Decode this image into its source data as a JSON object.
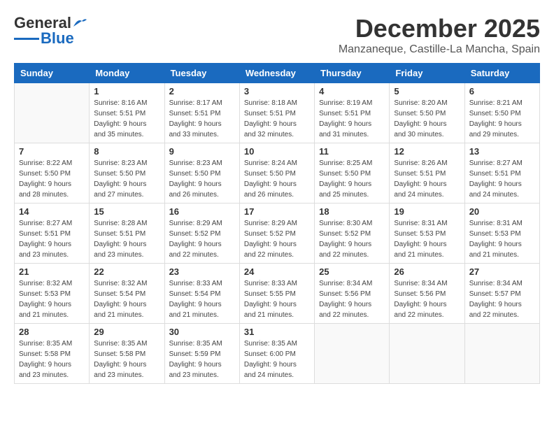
{
  "header": {
    "logo_general": "General",
    "logo_blue": "Blue",
    "month": "December 2025",
    "location": "Manzaneque, Castille-La Mancha, Spain"
  },
  "calendar": {
    "days_of_week": [
      "Sunday",
      "Monday",
      "Tuesday",
      "Wednesday",
      "Thursday",
      "Friday",
      "Saturday"
    ],
    "weeks": [
      [
        {
          "day": "",
          "info": ""
        },
        {
          "day": "1",
          "info": "Sunrise: 8:16 AM\nSunset: 5:51 PM\nDaylight: 9 hours\nand 35 minutes."
        },
        {
          "day": "2",
          "info": "Sunrise: 8:17 AM\nSunset: 5:51 PM\nDaylight: 9 hours\nand 33 minutes."
        },
        {
          "day": "3",
          "info": "Sunrise: 8:18 AM\nSunset: 5:51 PM\nDaylight: 9 hours\nand 32 minutes."
        },
        {
          "day": "4",
          "info": "Sunrise: 8:19 AM\nSunset: 5:51 PM\nDaylight: 9 hours\nand 31 minutes."
        },
        {
          "day": "5",
          "info": "Sunrise: 8:20 AM\nSunset: 5:50 PM\nDaylight: 9 hours\nand 30 minutes."
        },
        {
          "day": "6",
          "info": "Sunrise: 8:21 AM\nSunset: 5:50 PM\nDaylight: 9 hours\nand 29 minutes."
        }
      ],
      [
        {
          "day": "7",
          "info": "Sunrise: 8:22 AM\nSunset: 5:50 PM\nDaylight: 9 hours\nand 28 minutes."
        },
        {
          "day": "8",
          "info": "Sunrise: 8:23 AM\nSunset: 5:50 PM\nDaylight: 9 hours\nand 27 minutes."
        },
        {
          "day": "9",
          "info": "Sunrise: 8:23 AM\nSunset: 5:50 PM\nDaylight: 9 hours\nand 26 minutes."
        },
        {
          "day": "10",
          "info": "Sunrise: 8:24 AM\nSunset: 5:50 PM\nDaylight: 9 hours\nand 26 minutes."
        },
        {
          "day": "11",
          "info": "Sunrise: 8:25 AM\nSunset: 5:50 PM\nDaylight: 9 hours\nand 25 minutes."
        },
        {
          "day": "12",
          "info": "Sunrise: 8:26 AM\nSunset: 5:51 PM\nDaylight: 9 hours\nand 24 minutes."
        },
        {
          "day": "13",
          "info": "Sunrise: 8:27 AM\nSunset: 5:51 PM\nDaylight: 9 hours\nand 24 minutes."
        }
      ],
      [
        {
          "day": "14",
          "info": "Sunrise: 8:27 AM\nSunset: 5:51 PM\nDaylight: 9 hours\nand 23 minutes."
        },
        {
          "day": "15",
          "info": "Sunrise: 8:28 AM\nSunset: 5:51 PM\nDaylight: 9 hours\nand 23 minutes."
        },
        {
          "day": "16",
          "info": "Sunrise: 8:29 AM\nSunset: 5:52 PM\nDaylight: 9 hours\nand 22 minutes."
        },
        {
          "day": "17",
          "info": "Sunrise: 8:29 AM\nSunset: 5:52 PM\nDaylight: 9 hours\nand 22 minutes."
        },
        {
          "day": "18",
          "info": "Sunrise: 8:30 AM\nSunset: 5:52 PM\nDaylight: 9 hours\nand 22 minutes."
        },
        {
          "day": "19",
          "info": "Sunrise: 8:31 AM\nSunset: 5:53 PM\nDaylight: 9 hours\nand 21 minutes."
        },
        {
          "day": "20",
          "info": "Sunrise: 8:31 AM\nSunset: 5:53 PM\nDaylight: 9 hours\nand 21 minutes."
        }
      ],
      [
        {
          "day": "21",
          "info": "Sunrise: 8:32 AM\nSunset: 5:53 PM\nDaylight: 9 hours\nand 21 minutes."
        },
        {
          "day": "22",
          "info": "Sunrise: 8:32 AM\nSunset: 5:54 PM\nDaylight: 9 hours\nand 21 minutes."
        },
        {
          "day": "23",
          "info": "Sunrise: 8:33 AM\nSunset: 5:54 PM\nDaylight: 9 hours\nand 21 minutes."
        },
        {
          "day": "24",
          "info": "Sunrise: 8:33 AM\nSunset: 5:55 PM\nDaylight: 9 hours\nand 21 minutes."
        },
        {
          "day": "25",
          "info": "Sunrise: 8:34 AM\nSunset: 5:56 PM\nDaylight: 9 hours\nand 22 minutes."
        },
        {
          "day": "26",
          "info": "Sunrise: 8:34 AM\nSunset: 5:56 PM\nDaylight: 9 hours\nand 22 minutes."
        },
        {
          "day": "27",
          "info": "Sunrise: 8:34 AM\nSunset: 5:57 PM\nDaylight: 9 hours\nand 22 minutes."
        }
      ],
      [
        {
          "day": "28",
          "info": "Sunrise: 8:35 AM\nSunset: 5:58 PM\nDaylight: 9 hours\nand 23 minutes."
        },
        {
          "day": "29",
          "info": "Sunrise: 8:35 AM\nSunset: 5:58 PM\nDaylight: 9 hours\nand 23 minutes."
        },
        {
          "day": "30",
          "info": "Sunrise: 8:35 AM\nSunset: 5:59 PM\nDaylight: 9 hours\nand 23 minutes."
        },
        {
          "day": "31",
          "info": "Sunrise: 8:35 AM\nSunset: 6:00 PM\nDaylight: 9 hours\nand 24 minutes."
        },
        {
          "day": "",
          "info": ""
        },
        {
          "day": "",
          "info": ""
        },
        {
          "day": "",
          "info": ""
        }
      ]
    ]
  }
}
